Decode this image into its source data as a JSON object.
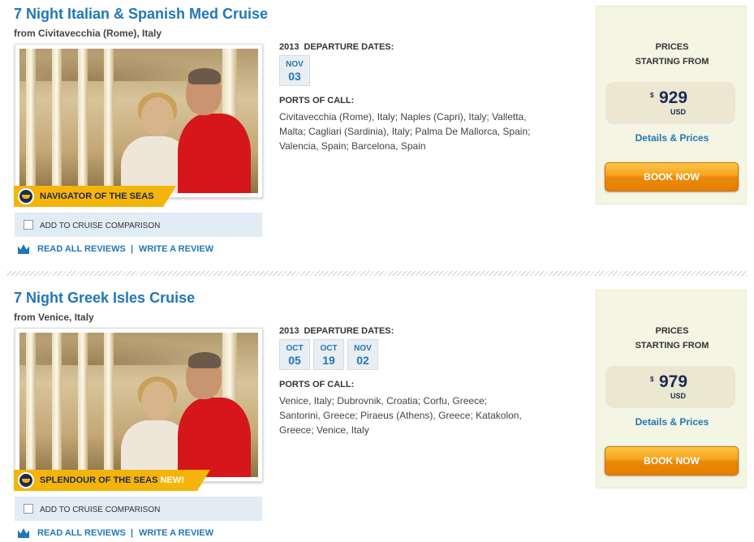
{
  "cruises": [
    {
      "title": "7 Night Italian & Spanish Med Cruise",
      "from": "from Civitavecchia (Rome), Italy",
      "ship": "NAVIGATOR OF THE SEAS",
      "ship_badge": "",
      "compare_label": "ADD TO CRUISE COMPARISON",
      "read_reviews": "READ ALL REVIEWS",
      "separator": "|",
      "write_review": "WRITE A REVIEW",
      "year": "2013",
      "departure_label": "DEPARTURE DATES:",
      "dates": [
        {
          "month": "NOV",
          "day": "03"
        }
      ],
      "ports_label": "PORTS OF CALL:",
      "ports": "Civitavecchia (Rome), Italy; Naples (Capri), Italy; Valletta, Malta; Cagliari (Sardinia), Italy; Palma De Mallorca, Spain; Valencia, Spain; Barcelona, Spain",
      "prices_label_1": "PRICES",
      "prices_label_2": "STARTING FROM",
      "currency_symbol": "$",
      "price": "929",
      "currency": "USD",
      "details_link": "Details & Prices",
      "book_button": "BOOK NOW"
    },
    {
      "title": "7 Night Greek Isles Cruise",
      "from": "from Venice, Italy",
      "ship": "SPLENDOUR OF THE SEAS",
      "ship_badge": "NEW!",
      "compare_label": "ADD TO CRUISE COMPARISON",
      "read_reviews": "READ ALL REVIEWS",
      "separator": "|",
      "write_review": "WRITE A REVIEW",
      "year": "2013",
      "departure_label": "DEPARTURE DATES:",
      "dates": [
        {
          "month": "OCT",
          "day": "05"
        },
        {
          "month": "OCT",
          "day": "19"
        },
        {
          "month": "NOV",
          "day": "02"
        }
      ],
      "ports_label": "PORTS OF CALL:",
      "ports": "Venice, Italy; Dubrovnik, Croatia; Corfu, Greece; Santorini, Greece; Piraeus (Athens), Greece; Katakolon, Greece; Venice, Italy",
      "prices_label_1": "PRICES",
      "prices_label_2": "STARTING FROM",
      "currency_symbol": "$",
      "price": "979",
      "currency": "USD",
      "details_link": "Details & Prices",
      "book_button": "BOOK NOW"
    }
  ],
  "colors": {
    "link_blue": "#1f77b8",
    "navy": "#1a2a57",
    "banner_yellow": "#f5b40a",
    "book_orange": "#ea8a0b",
    "price_box_bg": "#f5f5e3",
    "compare_bg": "#e1ecf5"
  }
}
